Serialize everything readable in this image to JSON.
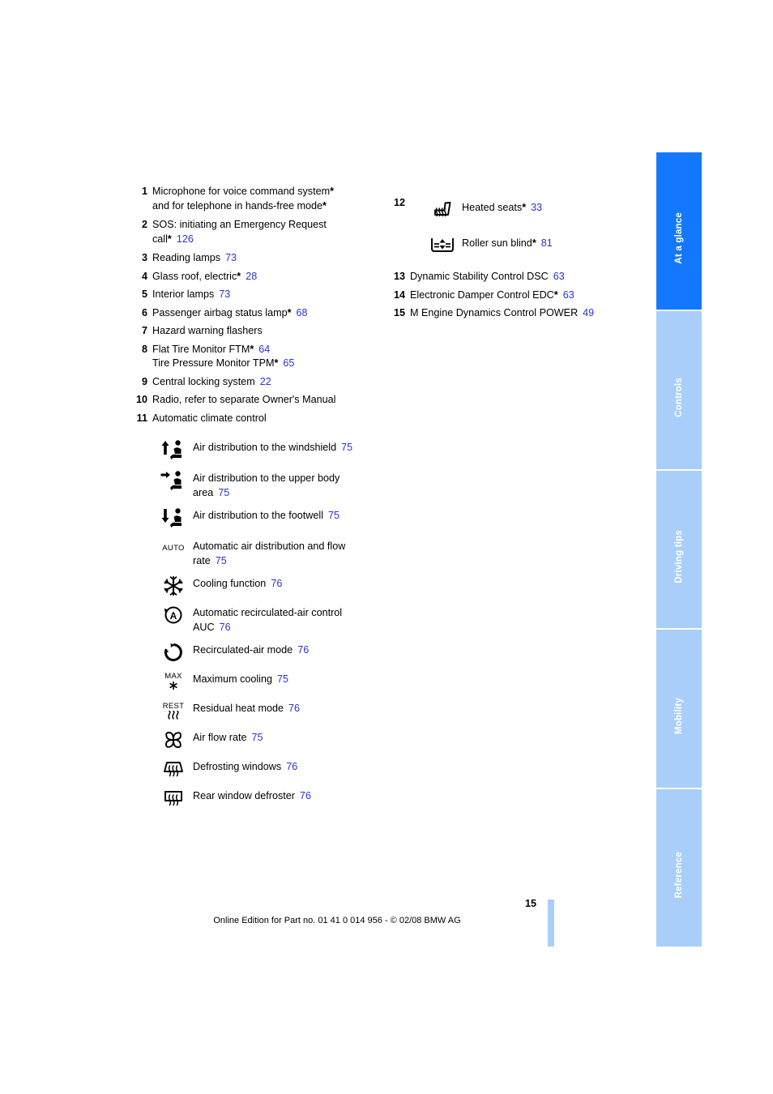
{
  "page": {
    "number": "15",
    "credit": "Online Edition for Part no. 01 41 0 014 956 - © 02/08 BMW AG"
  },
  "sidebar": {
    "tabs": [
      {
        "label": "At a glance",
        "active": true
      },
      {
        "label": "Controls",
        "active": false
      },
      {
        "label": "Driving tips",
        "active": false
      },
      {
        "label": "Mobility",
        "active": false
      },
      {
        "label": "Reference",
        "active": false
      }
    ]
  },
  "left_column": {
    "items": [
      {
        "num": "1",
        "text": "Microphone for voice command system",
        "star": "*",
        "text2": "and for telephone in hands-free mode",
        "star2": "*",
        "ref": ""
      },
      {
        "num": "2",
        "text": "SOS: initiating an Emergency Request",
        "star": "",
        "text2": "call",
        "star2": "*",
        "ref": "126"
      },
      {
        "num": "3",
        "text": "Reading lamps",
        "star": "",
        "ref": "73"
      },
      {
        "num": "4",
        "text": "Glass roof, electric",
        "star": "*",
        "ref": "28"
      },
      {
        "num": "5",
        "text": "Interior lamps",
        "star": "",
        "ref": "73"
      },
      {
        "num": "6",
        "text": "Passenger airbag status lamp",
        "star": "*",
        "ref": "68"
      },
      {
        "num": "7",
        "text": "Hazard warning flashers",
        "star": "",
        "ref": ""
      },
      {
        "num": "8",
        "text": "Flat Tire Monitor FTM",
        "star": "*",
        "ref": "64",
        "text2": "Tire Pressure Monitor TPM",
        "star2": "*",
        "ref2": "65"
      },
      {
        "num": "9",
        "text": "Central locking system",
        "star": "",
        "ref": "22"
      },
      {
        "num": "10",
        "text": "Radio, refer to separate Owner's Manual",
        "star": "",
        "ref": ""
      },
      {
        "num": "11",
        "text": "Automatic climate control",
        "star": "",
        "ref": ""
      }
    ],
    "climate_icons": [
      {
        "icon": "air-distribution-windshield-icon",
        "label": "Air distribution to the windshield",
        "ref": "75"
      },
      {
        "icon": "air-distribution-upper-body-icon",
        "label": "Air distribution to the upper body area",
        "ref": "75"
      },
      {
        "icon": "air-distribution-footwell-icon",
        "label": "Air distribution to the footwell",
        "ref": "75"
      },
      {
        "icon": "auto-climate-icon",
        "label": "Automatic air distribution and flow rate",
        "ref": "75"
      },
      {
        "icon": "snowflake-cooling-icon",
        "label": "Cooling function",
        "ref": "76"
      },
      {
        "icon": "auc-recirculation-icon",
        "label": "Automatic recirculated-air control AUC",
        "ref": "76"
      },
      {
        "icon": "recirculated-air-icon",
        "label": "Recirculated-air mode",
        "ref": "76"
      },
      {
        "icon": "max-cooling-icon",
        "label": "Maximum cooling",
        "ref": "75"
      },
      {
        "icon": "rest-residual-heat-icon",
        "label": "Residual heat mode",
        "ref": "76"
      },
      {
        "icon": "fan-air-flow-icon",
        "label": "Air flow rate",
        "ref": "75"
      },
      {
        "icon": "defrost-windshield-icon",
        "label": "Defrosting windows",
        "ref": "76"
      },
      {
        "icon": "rear-window-defroster-icon",
        "label": "Rear window defroster",
        "ref": "76"
      }
    ],
    "icon_text_labels": {
      "auto": "AUTO",
      "max": "MAX",
      "rest": "REST"
    }
  },
  "right_column": {
    "group_number": "12",
    "group_icons": [
      {
        "icon": "heated-seats-icon",
        "label": "Heated seats",
        "star": "*",
        "ref": "33"
      },
      {
        "icon": "roller-sun-blind-icon",
        "label": "Roller sun blind",
        "star": "*",
        "ref": "81"
      }
    ],
    "items": [
      {
        "num": "13",
        "text": "Dynamic Stability Control DSC",
        "star": "",
        "ref": "63"
      },
      {
        "num": "14",
        "text": "Electronic Damper Control EDC",
        "star": "*",
        "ref": "63"
      },
      {
        "num": "15",
        "text": "M Engine Dynamics Control POWER",
        "star": "",
        "ref": "49"
      }
    ]
  },
  "colors": {
    "tab_active": "#1478ff",
    "tab_inactive": "#a9cefa",
    "page_reference": "#2a32d8",
    "text": "#000000"
  }
}
